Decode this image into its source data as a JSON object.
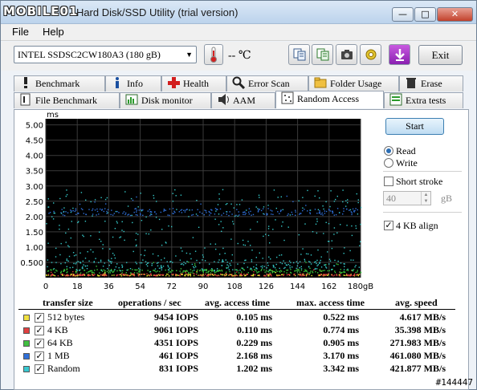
{
  "app": {
    "logo": "MOBILE01",
    "title": "HD Tune Pro 5.00 - Hard Disk/SSD Utility (trial version)",
    "title_visible": "- Hard Disk/SSD Utility (trial version)",
    "window_buttons": {
      "minimize": "—",
      "maximize": "□",
      "close": "✕"
    }
  },
  "menu": {
    "file": "File",
    "help": "Help"
  },
  "toolbar": {
    "drive": "INTEL SSDSC2CW180A3 (180 gB)",
    "temperature": "-- ℃",
    "exit_label": "Exit",
    "tool_icons": [
      "copy-info-icon",
      "copy-text-icon",
      "screenshot-camera-icon",
      "settings-icon",
      "download-icon"
    ]
  },
  "tabs_row1": [
    {
      "label": "Benchmark",
      "icon": "exclamation-icon"
    },
    {
      "label": "Info",
      "icon": "info-icon"
    },
    {
      "label": "Health",
      "icon": "health-cross-icon"
    },
    {
      "label": "Error Scan",
      "icon": "magnifier-icon"
    },
    {
      "label": "Folder Usage",
      "icon": "folder-icon"
    },
    {
      "label": "Erase",
      "icon": "trash-icon"
    }
  ],
  "tabs_row2": [
    {
      "label": "File Benchmark",
      "icon": "file-benchmark-icon"
    },
    {
      "label": "Disk monitor",
      "icon": "disk-monitor-icon"
    },
    {
      "label": "AAM",
      "icon": "speaker-icon"
    },
    {
      "label": "Random Access",
      "icon": "random-access-icon",
      "active": true
    },
    {
      "label": "Extra tests",
      "icon": "extra-tests-icon"
    }
  ],
  "controls": {
    "start_label": "Start",
    "read_label": "Read",
    "write_label": "Write",
    "mode": "Read",
    "short_stroke_label": "Short stroke",
    "short_stroke_checked": false,
    "short_stroke_value": "40",
    "short_stroke_unit": "gB",
    "align_label": "4 KB align",
    "align_checked": true
  },
  "chart_data": {
    "type": "scatter",
    "ylabel": "ms",
    "y_ticks": [
      "5.00",
      "4.50",
      "4.00",
      "3.50",
      "3.00",
      "2.50",
      "2.00",
      "1.50",
      "1.00",
      "0.500"
    ],
    "x_ticks": [
      "0",
      "18",
      "36",
      "54",
      "72",
      "90",
      "108",
      "126",
      "144",
      "162",
      "180gB"
    ],
    "xlim": [
      0,
      180
    ],
    "ylim": [
      0,
      5.2
    ],
    "grid": true,
    "series": [
      {
        "name": "512 bytes",
        "color": "#e8e830",
        "avg_ms": 0.105
      },
      {
        "name": "4 KB",
        "color": "#e04040",
        "avg_ms": 0.11
      },
      {
        "name": "64 KB",
        "color": "#39c83a",
        "avg_ms": 0.229
      },
      {
        "name": "1 MB",
        "color": "#2f6fd8",
        "avg_ms": 2.168
      },
      {
        "name": "Random",
        "color": "#35c8c8",
        "avg_ms": 1.202
      }
    ]
  },
  "table": {
    "headers": [
      "transfer size",
      "operations / sec",
      "avg. access time",
      "max. access time",
      "avg. speed"
    ],
    "rows": [
      {
        "label": "512 bytes",
        "color": "#f0e040",
        "checked": true,
        "ops": "9454 IOPS",
        "avg": "0.105 ms",
        "max": "0.522 ms",
        "speed": "4.617 MB/s"
      },
      {
        "label": "4 KB",
        "color": "#e04040",
        "checked": true,
        "ops": "9061 IOPS",
        "avg": "0.110 ms",
        "max": "0.774 ms",
        "speed": "35.398 MB/s"
      },
      {
        "label": "64 KB",
        "color": "#40c040",
        "checked": true,
        "ops": "4351 IOPS",
        "avg": "0.229 ms",
        "max": "0.905 ms",
        "speed": "271.983 MB/s"
      },
      {
        "label": "1 MB",
        "color": "#3070d8",
        "checked": true,
        "ops": "461 IOPS",
        "avg": "2.168 ms",
        "max": "3.170 ms",
        "speed": "461.080 MB/s"
      },
      {
        "label": "Random",
        "color": "#38c8d0",
        "checked": true,
        "ops": "831 IOPS",
        "avg": "1.202 ms",
        "max": "3.342 ms",
        "speed": "421.877 MB/s"
      }
    ]
  },
  "watermark": "#144447"
}
